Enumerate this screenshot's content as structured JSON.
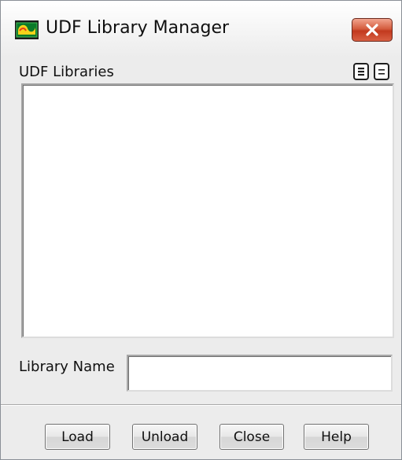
{
  "window": {
    "title": "UDF Library Manager",
    "app_icon": "fluent-app-icon",
    "close_icon": "close-icon"
  },
  "libraries": {
    "label": "UDF Libraries",
    "select_all_icon": "select-all-icon",
    "deselect_all_icon": "deselect-all-icon",
    "items": []
  },
  "library_name": {
    "label": "Library Name",
    "value": "",
    "placeholder": ""
  },
  "buttons": {
    "load": "Load",
    "unload": "Unload",
    "close": "Close",
    "help": "Help"
  },
  "colors": {
    "close_button": "#c23a1f",
    "window_bg": "#ececec"
  }
}
